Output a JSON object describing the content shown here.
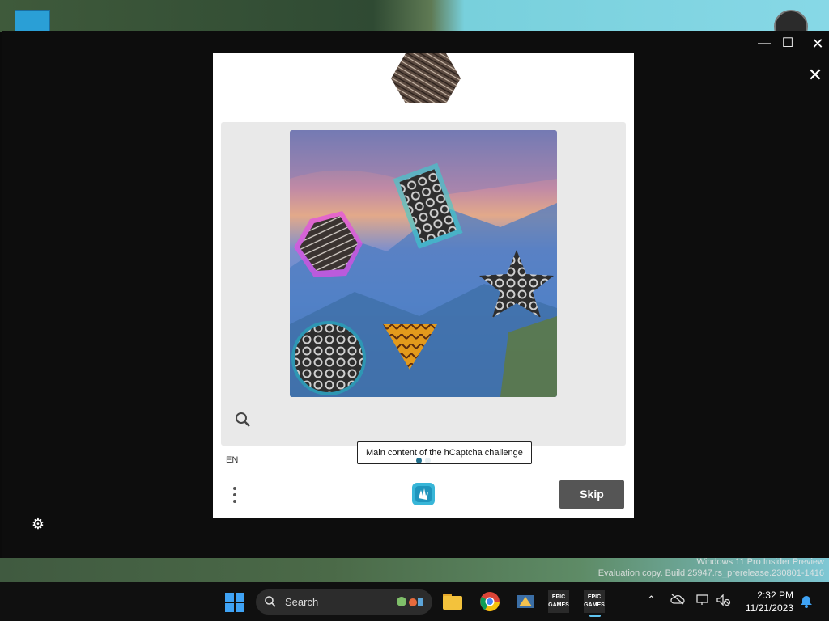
{
  "window": {
    "minimize_label": "—",
    "maximize_label": "☐",
    "close_label": "✕",
    "overlay_close_label": "✕"
  },
  "captcha": {
    "tooltip_text": "Main content of the hCaptcha challenge",
    "language": "EN",
    "skip_label": "Skip",
    "colors": {
      "panel": "#e9e9e9",
      "skip_bg": "#555555",
      "accent": "#1f6e8c"
    }
  },
  "taskbar": {
    "search_placeholder": "Search",
    "epic_label_1": "EPIC GAMES",
    "epic_label_2": "EPIC GAMES",
    "time": "2:32 PM",
    "date": "11/21/2023"
  },
  "watermark": {
    "line1": "Windows 11 Pro Insider Preview",
    "line2": "Evaluation copy. Build 25947.rs_prerelease.230801-1416"
  },
  "settings": {
    "gear_glyph": "⚙"
  }
}
